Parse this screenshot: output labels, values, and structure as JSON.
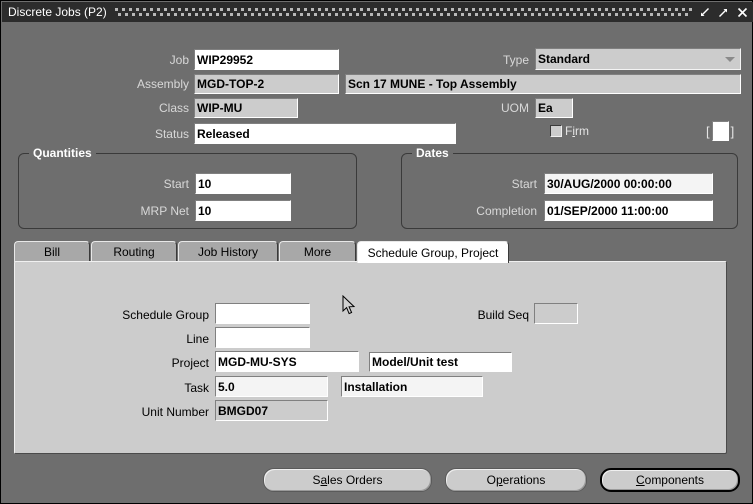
{
  "window": {
    "title": "Discrete Jobs (P2)",
    "controls": [
      {
        "name": "restore-down",
        "glyph": "restore"
      },
      {
        "name": "maximize",
        "glyph": "maximize"
      },
      {
        "name": "close",
        "glyph": "close"
      }
    ]
  },
  "header": {
    "job_label": "Job",
    "job_value": "WIP29952",
    "type_label": "Type",
    "type_value": "Standard",
    "assembly_label": "Assembly",
    "assembly_value": "MGD-TOP-2",
    "assembly_description": "Scn 17 MUNE - Top Assembly",
    "class_label": "Class",
    "class_value": "WIP-MU",
    "uom_label": "UOM",
    "uom_value": "Ea",
    "status_label": "Status",
    "status_value": "Released",
    "firm_label_pre": "F",
    "firm_label_mnemonic": "i",
    "firm_label_post": "rm",
    "firm_checked": false,
    "flexfield_open": "[",
    "flexfield_close": "]",
    "flexfield_value": ""
  },
  "quantities": {
    "group_label": "Quantities",
    "start_label": "Start",
    "start_value": "10",
    "mrp_net_label": "MRP Net",
    "mrp_net_value": "10"
  },
  "dates": {
    "group_label": "Dates",
    "start_label": "Start",
    "start_value": "30/AUG/2000 00:00:00",
    "completion_label": "Completion",
    "completion_value": "01/SEP/2000 11:00:00"
  },
  "tabs": [
    {
      "label": "Bill",
      "active": false
    },
    {
      "label": "Routing",
      "active": false
    },
    {
      "label": "Job History",
      "active": false
    },
    {
      "label": "More",
      "active": false
    },
    {
      "label": "Schedule Group, Project",
      "active": true
    }
  ],
  "tab_panel": {
    "schedule_group_label": "Schedule Group",
    "schedule_group_value": "",
    "build_seq_label": "Build Seq",
    "build_seq_value": "",
    "line_label": "Line",
    "line_value": "",
    "project_label": "Project",
    "project_value": "MGD-MU-SYS",
    "project_description": "Model/Unit test",
    "task_label": "Task",
    "task_value": "5.0",
    "task_description": "Installation",
    "unit_number_label": "Unit Number",
    "unit_number_value": "BMGD07"
  },
  "buttons": [
    {
      "pre": "S",
      "mnemonic": "a",
      "post": "les Orders",
      "name": "sales-orders",
      "focus": false
    },
    {
      "pre": "O",
      "mnemonic": "p",
      "post": "erations",
      "name": "operations",
      "focus": false
    },
    {
      "pre": "",
      "mnemonic": "C",
      "post": "omponents",
      "name": "components",
      "focus": true
    }
  ],
  "colors": {
    "form_background": "#6e6e6e",
    "panel_background": "#cccccc",
    "titlebar_background": "#2c2c2c",
    "field_background": "#ffffff",
    "readonly_field_background": "#cccccc",
    "label_text": "#d8d8d8"
  }
}
